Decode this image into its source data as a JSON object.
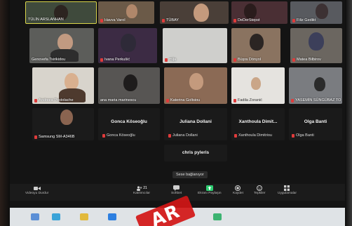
{
  "participants": [
    {
      "name": "TÜLİN ARSLANHAN"
    },
    {
      "name": "Havva Varol"
    },
    {
      "name": "TÜBAY"
    },
    {
      "name": "DeDerStepst"
    },
    {
      "name": "Filiz Gedikt"
    },
    {
      "name": "Genovefa Tsirikidou"
    },
    {
      "name": "Ivana Perkušić"
    },
    {
      "name": "mija"
    },
    {
      "name": "Büşra Dönyol"
    },
    {
      "name": "Matea Bilbirov"
    },
    {
      "name": "Andreea Postolache"
    },
    {
      "name": "ana maria marinescu"
    },
    {
      "name": "Katerina Goltsiou"
    },
    {
      "name": "Fadila Zoranić"
    },
    {
      "name": "YASEMİN SÜNGÜBAZ TO"
    },
    {
      "name": "Samsung SM-A346B"
    }
  ],
  "text_tiles": [
    {
      "big": "Gonca Köseoğlu",
      "small": "Gonca Köseoğlu"
    },
    {
      "big": "Juliana Dollani",
      "small": "Juliana Dollani"
    },
    {
      "big": "Xanthoula Dimit...",
      "small": "Xanthoula Dimitriou"
    },
    {
      "big": "Olga Banti",
      "small": "Olga Banti"
    },
    {
      "big": "chris pyleris",
      "small": ""
    }
  ],
  "speaker_note": "Sese bağlanıyor",
  "toolbar": {
    "video_label": "Videoyu Durdur",
    "participants_count": "21",
    "participants_label": "Katılımcılar",
    "chat_label": "Sohbet",
    "share_label": "Ekranı Paylaşın",
    "record_label": "Kaydet",
    "reactions_label": "Tepkiler",
    "apps_label": "Uygulamalar"
  },
  "stamp_text": "AR",
  "colors": {
    "accent_green": "#2ecc71",
    "mic_muted": "#e03b3b",
    "stamp_red": "#d31616"
  },
  "icons": [
    "video-camera-icon",
    "participants-icon",
    "chat-icon",
    "share-screen-icon",
    "record-icon",
    "reactions-icon",
    "apps-icon",
    "mic-muted-icon"
  ]
}
